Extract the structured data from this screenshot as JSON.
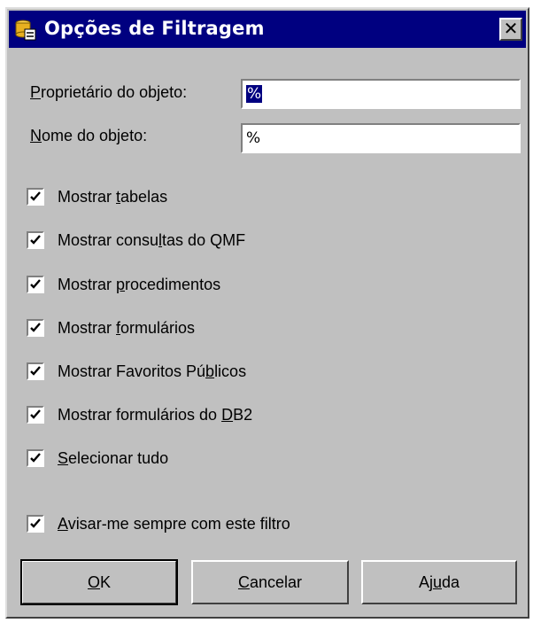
{
  "window": {
    "title": "Opções de Filtragem",
    "close_glyph": "✕",
    "icon": "database-icon"
  },
  "fields": [
    {
      "label_ul": "P",
      "label_rest": "roprietário do objeto:",
      "value": "%",
      "selected": true
    },
    {
      "label_ul": "N",
      "label_rest": "ome do objeto:",
      "value": "%",
      "selected": false
    }
  ],
  "checkboxes": [
    {
      "pre": "Mostrar ",
      "ul": "t",
      "post": "abelas",
      "checked": true
    },
    {
      "pre": "Mostrar consu",
      "ul": "l",
      "post": "tas do QMF",
      "checked": true
    },
    {
      "pre": "Mostrar ",
      "ul": "p",
      "post": "rocedimentos",
      "checked": true
    },
    {
      "pre": "Mostrar ",
      "ul": "f",
      "post": "ormulários",
      "checked": true
    },
    {
      "pre": "Mostrar Favoritos Pú",
      "ul": "b",
      "post": "licos",
      "checked": true
    },
    {
      "pre": "Mostrar formulários do ",
      "ul": "D",
      "post": "B2",
      "checked": true
    },
    {
      "pre": "",
      "ul": "S",
      "post": "elecionar tudo",
      "checked": true
    }
  ],
  "warn_checkbox": {
    "pre": "",
    "ul": "A",
    "post": "visar-me sempre com este filtro",
    "checked": true
  },
  "buttons": {
    "ok": {
      "pre": "",
      "ul": "O",
      "post": "K"
    },
    "cancel": {
      "pre": "",
      "ul": "C",
      "post": "ancelar"
    },
    "help": {
      "pre": "Aj",
      "ul": "u",
      "post": "da"
    }
  }
}
